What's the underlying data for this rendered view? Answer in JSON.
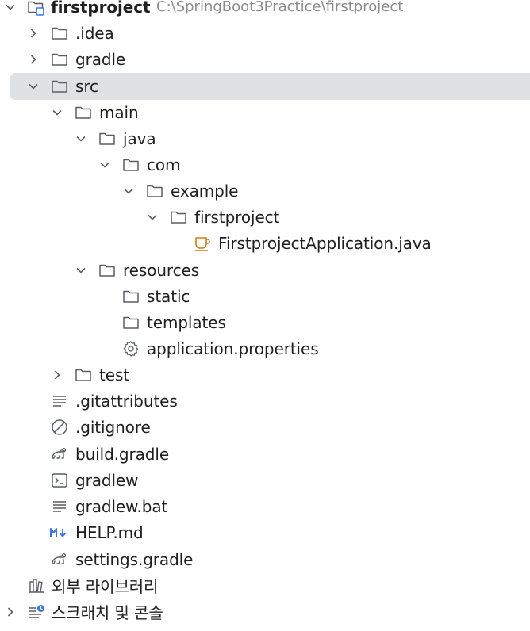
{
  "project": {
    "name": "firstproject",
    "path": "C:\\SpringBoot3Practice\\firstproject"
  },
  "tree": {
    "idea": ".idea",
    "gradle": "gradle",
    "src": "src",
    "main": "main",
    "java": "java",
    "com": "com",
    "example": "example",
    "firstproject": "firstproject",
    "app_class": "FirstprojectApplication.java",
    "resources": "resources",
    "static": "static",
    "templates": "templates",
    "app_properties": "application.properties",
    "test": "test",
    "gitattributes": ".gitattributes",
    "gitignore": ".gitignore",
    "build_gradle": "build.gradle",
    "gradlew": "gradlew",
    "gradlew_bat": "gradlew.bat",
    "help_md": "HELP.md",
    "settings_gradle": "settings.gradle"
  },
  "extra": {
    "external_libraries": "외부 라이브러리",
    "scratches": "스크래치 및 콘솔"
  },
  "colors": {
    "selection": "#dfe1e5",
    "folder_stroke": "#5a5d63",
    "java_orange": "#d27f14",
    "markdown_blue": "#3574f0",
    "module_blue": "#3574f0",
    "path_gray": "#8c8c8c"
  },
  "icons": {
    "chevron_expanded": "chevron-down-icon",
    "chevron_collapsed": "chevron-right-icon",
    "folder": "folder-icon",
    "module": "module-folder-icon",
    "java": "java-class-icon",
    "settings": "gear-icon",
    "text": "text-lines-icon",
    "ignore": "ignore-icon",
    "gradle": "gradle-elephant-icon",
    "terminal": "terminal-icon",
    "markdown": "markdown-icon",
    "library": "library-icon",
    "scratch": "scratch-icon"
  }
}
